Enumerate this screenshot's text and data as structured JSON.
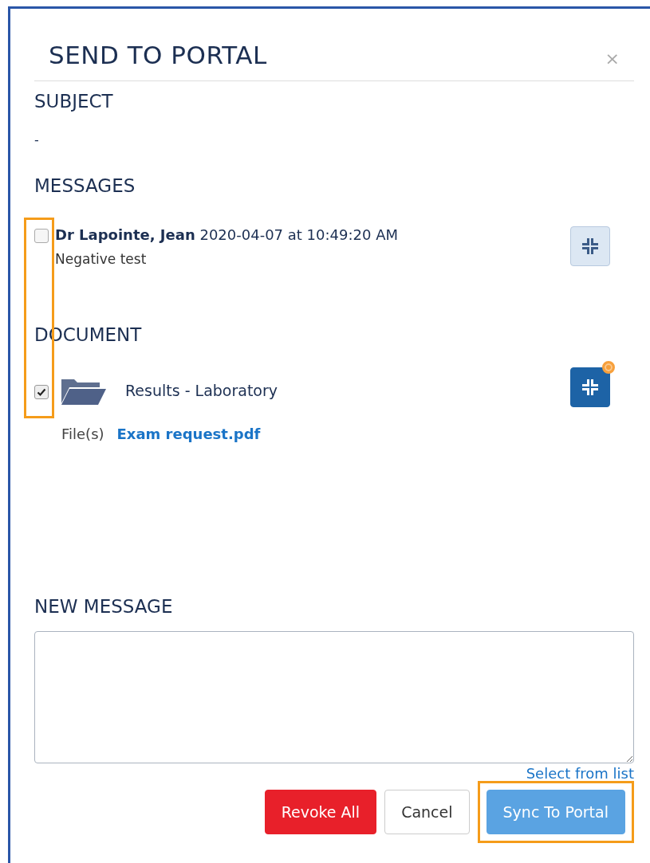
{
  "dialog": {
    "title": "SEND TO PORTAL",
    "close": "×"
  },
  "subject": {
    "heading": "SUBJECT",
    "value": "-"
  },
  "messages": {
    "heading": "MESSAGES",
    "items": [
      {
        "author": "Dr Lapointe, Jean",
        "timestamp": "2020-04-07 at 10:49:20 AM",
        "text": "Negative test",
        "checked": false,
        "synced": false
      }
    ]
  },
  "documents": {
    "heading": "DOCUMENT",
    "items": [
      {
        "name": "Results - Laboratory",
        "checked": true,
        "synced": true,
        "pending": true,
        "files_label": "File(s)",
        "files": [
          "Exam request.pdf"
        ]
      }
    ]
  },
  "new_message": {
    "heading": "NEW MESSAGE",
    "link": "Select from list"
  },
  "checkbox_column_highlighted": true,
  "buttons": [
    {
      "label": "Revoke All",
      "kind": "danger",
      "highlighted": false
    },
    {
      "label": "Cancel",
      "kind": "default",
      "highlighted": false
    },
    {
      "label": "Sync To Portal",
      "kind": "primary",
      "highlighted": true
    }
  ]
}
